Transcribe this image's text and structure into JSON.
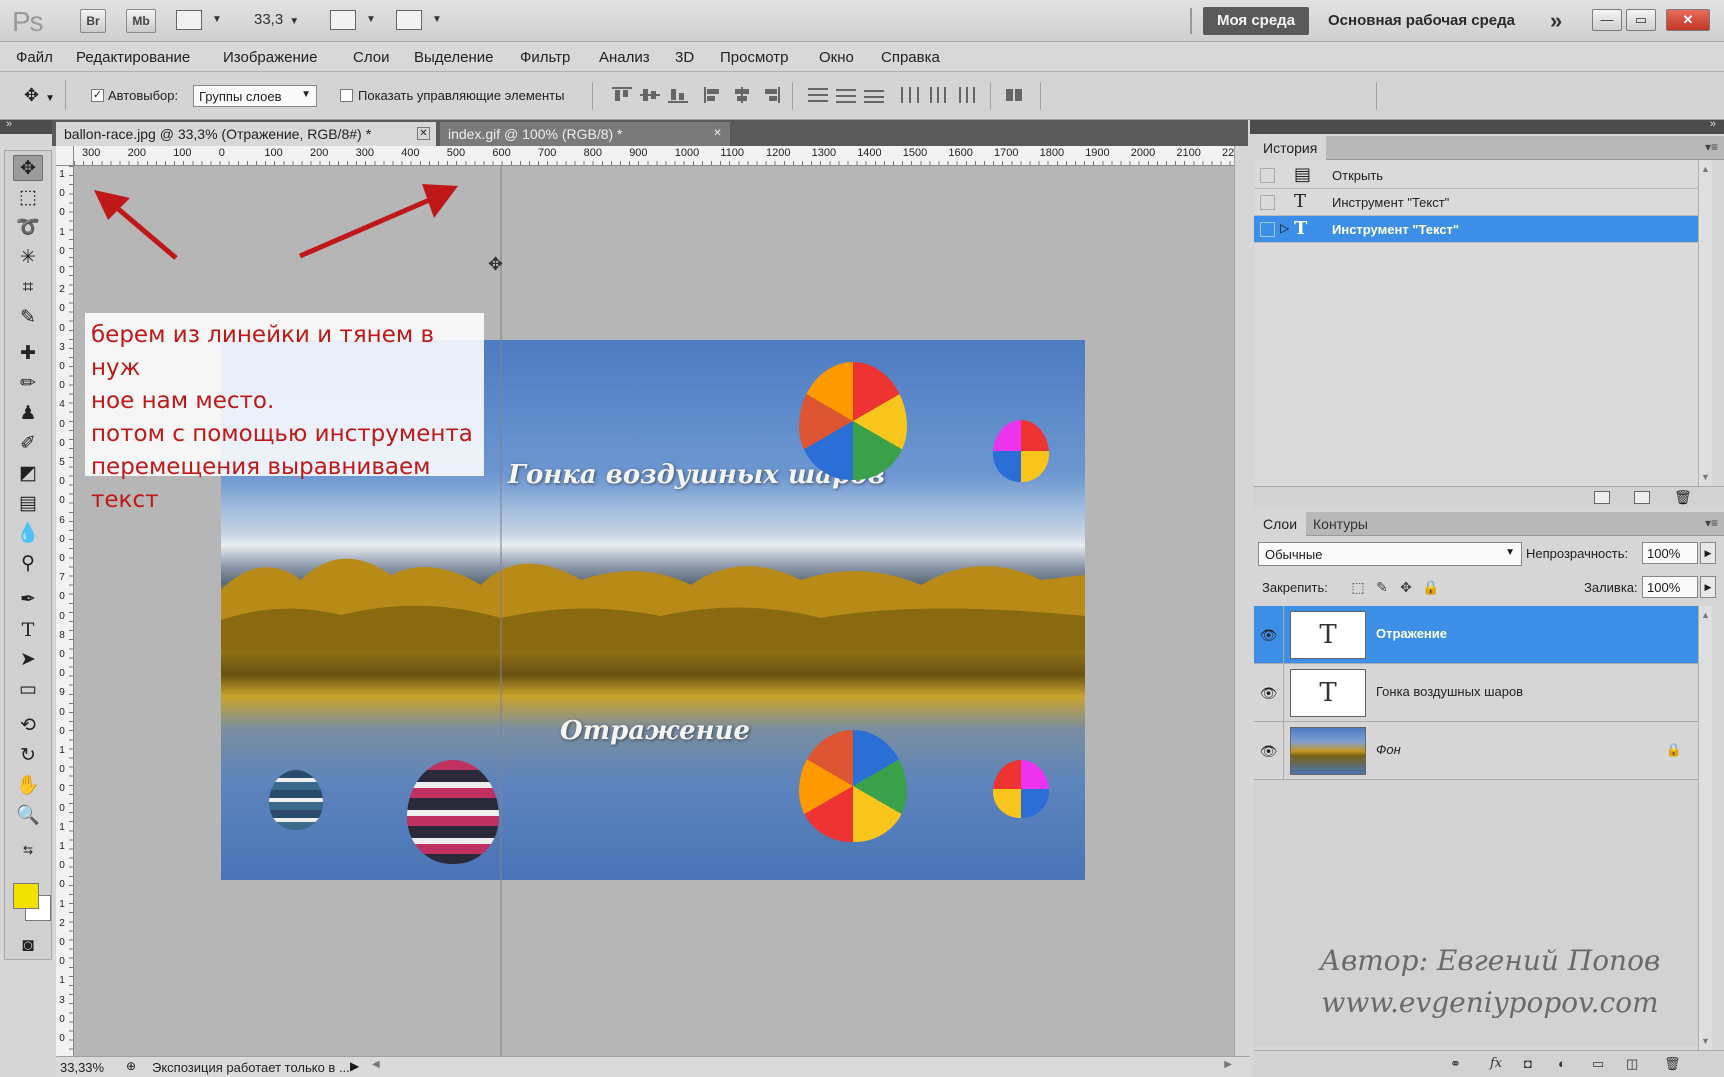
{
  "titlebar": {
    "logo": "Ps",
    "bridge": "Br",
    "minibridge": "Mb",
    "zoom": "33,3",
    "workspace_active": "Моя среда",
    "workspace_name": "Основная рабочая среда",
    "more": "»"
  },
  "menu": [
    "Файл",
    "Редактирование",
    "Изображение",
    "Слои",
    "Выделение",
    "Фильтр",
    "Анализ",
    "3D",
    "Просмотр",
    "Окно",
    "Справка"
  ],
  "options": {
    "autoselect_label": "Автовыбор:",
    "autoselect_checked": true,
    "autoselect_value": "Группы слоев",
    "show_controls_label": "Показать управляющие элементы",
    "show_controls_checked": false
  },
  "tabs": [
    {
      "label": "ballon-race.jpg @ 33,3% (Отражение, RGB/8#) *",
      "active": true
    },
    {
      "label": "index.gif @ 100% (RGB/8) *",
      "active": false
    }
  ],
  "ruler_h": [
    "300",
    "200",
    "100",
    "0",
    "100",
    "200",
    "300",
    "400",
    "500",
    "600",
    "700",
    "800",
    "900",
    "1000",
    "1100",
    "1200",
    "1300",
    "1400",
    "1500",
    "1600",
    "1700",
    "1800",
    "1900",
    "2000",
    "2100",
    "2200"
  ],
  "ruler_v": [
    "1",
    "0",
    "0",
    "1",
    "0",
    "0",
    "2",
    "0",
    "0",
    "3",
    "0",
    "0",
    "4",
    "0",
    "0",
    "5",
    "0",
    "0",
    "6",
    "0",
    "0",
    "7",
    "0",
    "0",
    "8",
    "0",
    "0",
    "9",
    "0",
    "0",
    "1",
    "0",
    "0",
    "0",
    "1",
    "1",
    "0",
    "0",
    "1",
    "2",
    "0",
    "0",
    "1",
    "3",
    "0",
    "0"
  ],
  "canvas": {
    "title_text": "Гонка воздушных шаров",
    "reflection_text": "Отражение",
    "note_lines": [
      "берем из линейки и тянем в нуж",
      "ное нам место.",
      "потом с помощью инструмента",
      "перемещения выравниваем",
      "текст"
    ],
    "accent_red": "#c01818"
  },
  "status": {
    "zoom": "33,33%",
    "info": "Экспозиция работает только в ..."
  },
  "history": {
    "tab": "История",
    "items": [
      {
        "label": "Открыть",
        "icon": "open-doc-icon",
        "selected": false
      },
      {
        "label": "Инструмент \"Текст\"",
        "icon": "text-tool-icon",
        "selected": false
      },
      {
        "label": "Инструмент \"Текст\"",
        "icon": "text-tool-icon",
        "selected": true
      }
    ]
  },
  "layers": {
    "tabs": [
      "Слои",
      "Контуры"
    ],
    "blend_mode": "Обычные",
    "opacity_label": "Непрозрачность:",
    "opacity_value": "100%",
    "lock_label": "Закрепить:",
    "fill_label": "Заливка:",
    "fill_value": "100%",
    "items": [
      {
        "name": "Отражение",
        "type": "text",
        "selected": true
      },
      {
        "name": "Гонка воздушных шаров",
        "type": "text",
        "selected": false
      },
      {
        "name": "Фон",
        "type": "image",
        "selected": false,
        "locked": true
      }
    ]
  },
  "watermark": {
    "author": "Автор: Евгений Попов",
    "site": "www.evgeniypopov.com"
  },
  "colors": {
    "selection_blue": "#3d8ee6",
    "foreground": "#f2e200",
    "background": "#ffffff"
  }
}
